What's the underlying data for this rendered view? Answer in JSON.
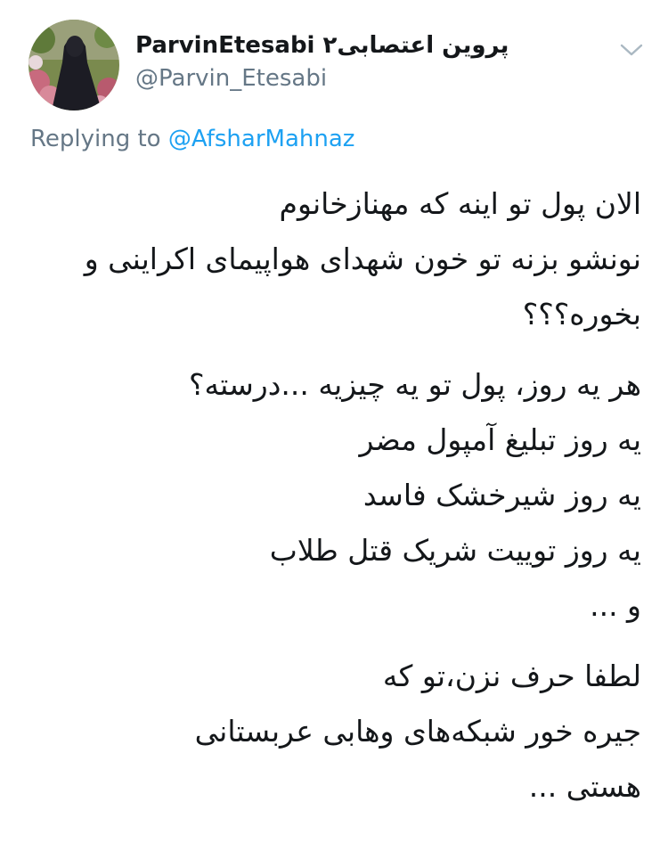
{
  "author": {
    "display_name": "ParvinEtesabi پروین اعتصابی۲",
    "handle": "@Parvin_Etesabi"
  },
  "reply": {
    "prefix": "Replying to",
    "mention": "@AfsharMahnaz"
  },
  "tweet": {
    "paragraphs": [
      [
        "الان پول تو اینه که مهنازخانوم",
        "نونشو بزنه تو خون شهدای هواپیمای اکراینی و",
        "بخوره؟؟؟"
      ],
      [
        "هر یه روز، پول تو یه چیزیه ...درسته؟",
        "یه روز تبلیغ آمپول مضر",
        "یه روز شیرخشک فاسد",
        "یه روز توییت شریک قتل طلاب",
        "و ..."
      ],
      [
        "لطفا حرف نزن،تو که",
        "جیره خور شبکه‌های وهابی عربستانی",
        "هستی ..."
      ]
    ]
  },
  "icons": {
    "menu_caret": "chevron-down-icon",
    "avatar": "profile-photo"
  },
  "colors": {
    "text": "#14171a",
    "secondary": "#657786",
    "link": "#1da1f2"
  }
}
